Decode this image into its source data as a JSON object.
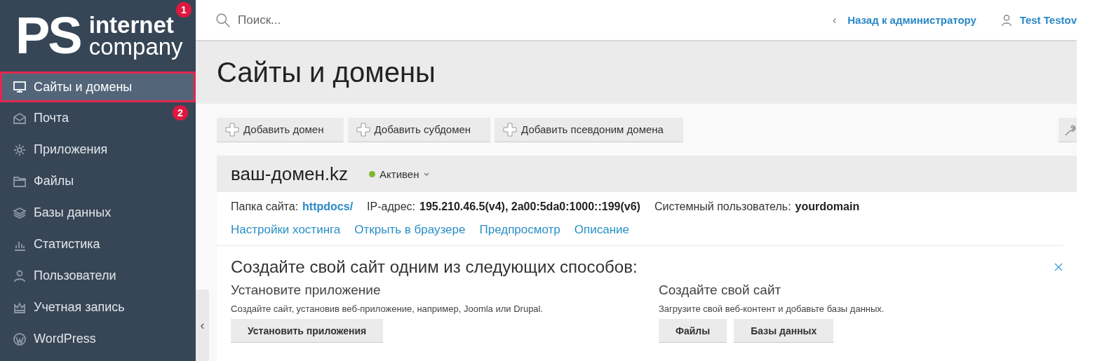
{
  "logo": {
    "mark": "PS",
    "line1": "internet",
    "line2": "company"
  },
  "annotations": [
    {
      "label": "1"
    },
    {
      "label": "2"
    }
  ],
  "sidebar": {
    "items": [
      {
        "label": "Сайты и домены",
        "selected": true
      },
      {
        "label": "Почта",
        "selected": false
      },
      {
        "label": "Приложения",
        "selected": false
      },
      {
        "label": "Файлы",
        "selected": false
      },
      {
        "label": "Базы данных",
        "selected": false
      },
      {
        "label": "Статистика",
        "selected": false
      },
      {
        "label": "Пользователи",
        "selected": false
      },
      {
        "label": "Учетная запись",
        "selected": false
      },
      {
        "label": "WordPress",
        "selected": false
      }
    ],
    "collapse": "‹"
  },
  "topbar": {
    "search": {
      "placeholder": "Поиск..."
    },
    "back_arrow": "‹",
    "back": "Назад к администратору",
    "user": "Test Testov"
  },
  "page_title": "Сайты и домены",
  "toolbar": [
    "Добавить домен",
    "Добавить субдомен",
    "Добавить псевдоним домена"
  ],
  "domain": {
    "name": "ваш-домен.kz",
    "status": {
      "label": "Активен",
      "color": "#7cb82f"
    },
    "folder_label": "Папка сайта:",
    "folder": "httpdocs/",
    "ip_label": "IP-адрес:",
    "ip": "195.210.46.5(v4), 2a00:5da0:1000::199(v6)",
    "user_label": "Системный пользователь:",
    "user": "yourdomain",
    "links": [
      "Настройки хостинга",
      "Открыть в браузере",
      "Предпросмотр",
      "Описание"
    ]
  },
  "create": {
    "title": "Создайте свой сайт одним из следующих способов:",
    "columns": [
      {
        "title": "Установите приложение",
        "text": "Создайте сайт, установив веб-приложение, например, Joomla или Drupal.",
        "buttons": [
          "Установить приложения"
        ]
      },
      {
        "title": "Создайте свой сайт",
        "text": "Загрузите свой веб-контент и добавьте базы данных.",
        "buttons": [
          "Файлы",
          "Базы данных"
        ]
      }
    ]
  }
}
